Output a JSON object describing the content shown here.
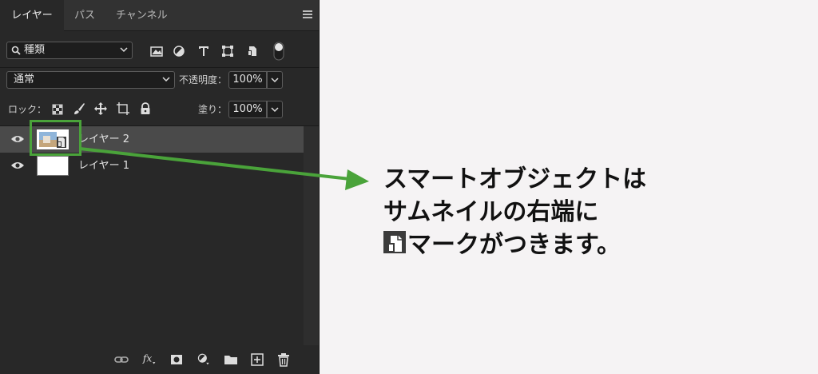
{
  "tabs": [
    {
      "label": "レイヤー",
      "active": true
    },
    {
      "label": "パス",
      "active": false
    },
    {
      "label": "チャンネル",
      "active": false
    }
  ],
  "filter": {
    "label": "種類"
  },
  "filter_icons": [
    "image-filter-icon",
    "adjustment-filter-icon",
    "type-filter-icon",
    "shape-filter-icon",
    "smart-object-filter-icon",
    "filter-toggle-icon"
  ],
  "blend": {
    "mode": "通常",
    "opacity_label": "不透明度：",
    "opacity_value": "100%"
  },
  "lock": {
    "label": "ロック：",
    "fill_label": "塗り：",
    "fill_value": "100%"
  },
  "layers": [
    {
      "name": "レイヤー 2",
      "type": "smart-object",
      "visible": true,
      "selected": true
    },
    {
      "name": "レイヤー 1",
      "type": "pixel",
      "visible": true,
      "selected": false
    }
  ],
  "bottom_icons": [
    "link-layers-icon",
    "fx-icon",
    "layer-mask-icon",
    "adjustment-layer-icon",
    "new-group-icon",
    "new-layer-icon",
    "delete-layer-icon"
  ],
  "callout": {
    "line1": "スマートオブジェクトは",
    "line2": "サムネイルの右端に",
    "line3": "マークがつきます。"
  },
  "colors": {
    "panel_bg": "#282828",
    "selected_row": "#4a4a4a",
    "highlight_green": "#4aa33a",
    "page_bg": "#f5f3f4"
  }
}
